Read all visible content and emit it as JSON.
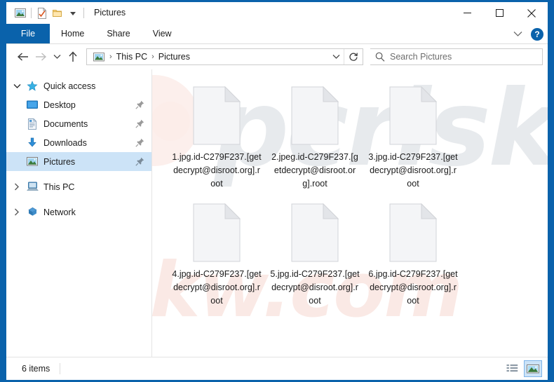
{
  "window": {
    "title": "Pictures",
    "quick_access_toolbar": [
      {
        "icon": "pictures-folder-icon",
        "name": "pictures-icon"
      },
      {
        "icon": "properties-icon",
        "name": "properties-icon"
      },
      {
        "icon": "new-folder-icon",
        "name": "new-folder-icon"
      },
      {
        "icon": "chevron-down-icon",
        "name": "customize-qat-icon"
      }
    ],
    "controls": {
      "minimize": "—",
      "maximize": "☐",
      "close": "✕"
    }
  },
  "ribbon": {
    "tabs": [
      {
        "label": "File",
        "selected": true
      },
      {
        "label": "Home",
        "selected": false
      },
      {
        "label": "Share",
        "selected": false
      },
      {
        "label": "View",
        "selected": false
      }
    ],
    "help_label": "?"
  },
  "navigation": {
    "back_tooltip": "Back",
    "forward_tooltip": "Forward",
    "recent_tooltip": "Recent locations",
    "up_tooltip": "Up",
    "breadcrumbs": [
      {
        "label": "This PC"
      },
      {
        "label": "Pictures"
      }
    ],
    "separator": "›",
    "refresh_tooltip": "Refresh"
  },
  "search": {
    "placeholder": "Search Pictures"
  },
  "sidebar": {
    "items": [
      {
        "label": "Quick access",
        "icon": "star-icon",
        "level": 0,
        "expander": "chevron-down",
        "selected": false,
        "pinned": false
      },
      {
        "label": "Desktop",
        "icon": "desktop-icon",
        "level": 1,
        "expander": "none",
        "selected": false,
        "pinned": true
      },
      {
        "label": "Documents",
        "icon": "documents-icon",
        "level": 1,
        "expander": "none",
        "selected": false,
        "pinned": true
      },
      {
        "label": "Downloads",
        "icon": "downloads-icon",
        "level": 1,
        "expander": "none",
        "selected": false,
        "pinned": true
      },
      {
        "label": "Pictures",
        "icon": "pictures-icon",
        "level": 1,
        "expander": "none",
        "selected": true,
        "pinned": true
      },
      {
        "label": "This PC",
        "icon": "this-pc-icon",
        "level": 0,
        "expander": "chevron-right",
        "selected": false,
        "pinned": false
      },
      {
        "label": "Network",
        "icon": "network-icon",
        "level": 0,
        "expander": "chevron-right",
        "selected": false,
        "pinned": false
      }
    ]
  },
  "content": {
    "files": [
      {
        "name": "1.jpg.id-C279F237.[getdecrypt@disroot.org].root",
        "icon": "generic-file-icon"
      },
      {
        "name": "2.jpeg.id-C279F237.[getdecrypt@disroot.org].root",
        "icon": "generic-file-icon"
      },
      {
        "name": "3.jpg.id-C279F237.[getdecrypt@disroot.org].root",
        "icon": "generic-file-icon"
      },
      {
        "name": "4.jpg.id-C279F237.[getdecrypt@disroot.org].root",
        "icon": "generic-file-icon"
      },
      {
        "name": "5.jpg.id-C279F237.[getdecrypt@disroot.org].root",
        "icon": "generic-file-icon"
      },
      {
        "name": "6.jpg.id-C279F237.[getdecrypt@disroot.org].root",
        "icon": "generic-file-icon"
      }
    ],
    "watermark_top": "pcrisk",
    "watermark_bottom": "riskw.com"
  },
  "status": {
    "item_count": "6 items",
    "views": [
      {
        "name": "details-view",
        "active": false
      },
      {
        "name": "large-icons-view",
        "active": true
      }
    ]
  },
  "colors": {
    "accent": "#0a62ab",
    "selection": "#cce3f7",
    "selection_border": "#7eb4ea"
  }
}
